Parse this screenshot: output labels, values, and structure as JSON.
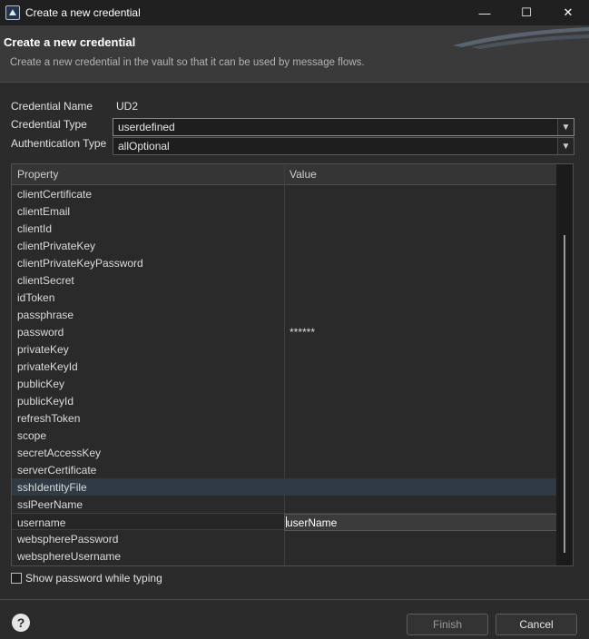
{
  "window": {
    "title": "Create a new credential",
    "icons": {
      "app": "app-icon",
      "minimize": "minimize-icon",
      "maximize": "maximize-icon",
      "close": "close-icon"
    }
  },
  "banner": {
    "title": "Create a new credential",
    "description": "Create a new credential in the vault so that it can be used by message flows."
  },
  "form": {
    "credential_name_label": "Credential Name",
    "credential_name_value": "UD2",
    "credential_type_label": "Credential Type",
    "credential_type_value": "userdefined",
    "auth_type_label": "Authentication Type",
    "auth_type_value": "allOptional"
  },
  "table": {
    "columns": [
      "Property",
      "Value"
    ],
    "rows": [
      {
        "property": "clientCertificate",
        "value": ""
      },
      {
        "property": "clientEmail",
        "value": ""
      },
      {
        "property": "clientId",
        "value": ""
      },
      {
        "property": "clientPrivateKey",
        "value": ""
      },
      {
        "property": "clientPrivateKeyPassword",
        "value": ""
      },
      {
        "property": "clientSecret",
        "value": ""
      },
      {
        "property": "idToken",
        "value": ""
      },
      {
        "property": "passphrase",
        "value": ""
      },
      {
        "property": "password",
        "value": "******"
      },
      {
        "property": "privateKey",
        "value": ""
      },
      {
        "property": "privateKeyId",
        "value": ""
      },
      {
        "property": "publicKey",
        "value": ""
      },
      {
        "property": "publicKeyId",
        "value": ""
      },
      {
        "property": "refreshToken",
        "value": ""
      },
      {
        "property": "scope",
        "value": ""
      },
      {
        "property": "secretAccessKey",
        "value": ""
      },
      {
        "property": "serverCertificate",
        "value": ""
      },
      {
        "property": "sshIdentityFile",
        "value": ""
      },
      {
        "property": "sslPeerName",
        "value": ""
      },
      {
        "property": "username",
        "value": "userName"
      },
      {
        "property": "webspherePassword",
        "value": ""
      },
      {
        "property": "websphereUsername",
        "value": ""
      }
    ]
  },
  "show_password_label": "Show password while typing",
  "buttons": {
    "finish": "Finish",
    "cancel": "Cancel"
  },
  "colors": {
    "background": "#2b2b2b",
    "titlebar": "#202020",
    "banner": "#3a3a3a",
    "hover_row": "#2f3a44"
  }
}
